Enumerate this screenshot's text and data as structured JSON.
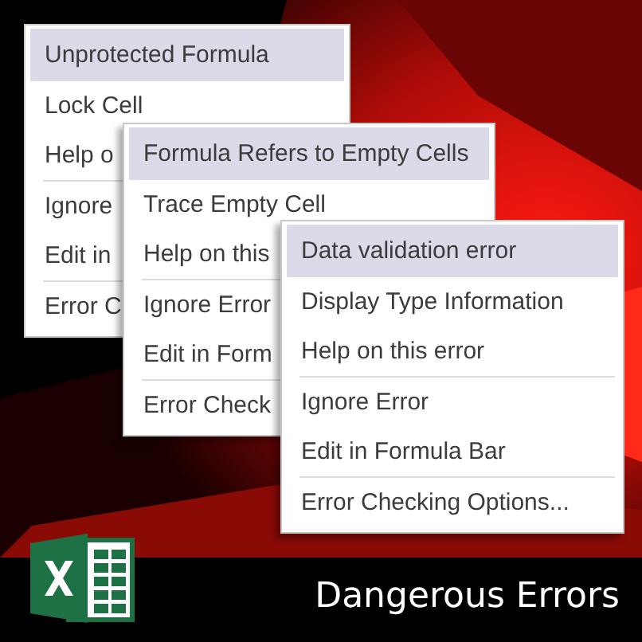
{
  "menus": [
    {
      "header": "Unprotected Formula",
      "items": [
        {
          "label": "Lock Cell",
          "separator_before": false
        },
        {
          "label": "Help o",
          "separator_before": false
        },
        {
          "label": "Ignore",
          "separator_before": true
        },
        {
          "label": "Edit in",
          "separator_before": false
        },
        {
          "label": "Error C",
          "separator_before": true
        }
      ]
    },
    {
      "header": "Formula Refers to Empty Cells",
      "items": [
        {
          "label": "Trace Empty Cell",
          "separator_before": false
        },
        {
          "label": "Help on this",
          "separator_before": false
        },
        {
          "label": "Ignore Error",
          "separator_before": true
        },
        {
          "label": "Edit in Form",
          "separator_before": false
        },
        {
          "label": "Error Check",
          "separator_before": true
        }
      ]
    },
    {
      "header": "Data validation error",
      "items": [
        {
          "label": "Display Type Information",
          "separator_before": false
        },
        {
          "label": "Help on this error",
          "separator_before": false
        },
        {
          "label": "Ignore Error",
          "separator_before": true
        },
        {
          "label": "Edit in Formula Bar",
          "separator_before": false
        },
        {
          "label": "Error Checking Options...",
          "separator_before": true
        }
      ]
    }
  ],
  "caption": "Dangerous Errors"
}
